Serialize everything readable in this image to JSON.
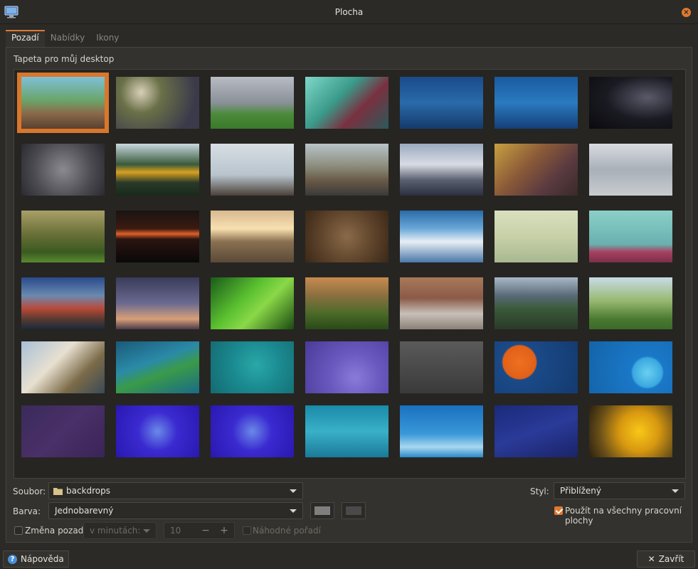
{
  "window": {
    "title": "Plocha"
  },
  "tabs": [
    {
      "label": "Pozadí",
      "active": true
    },
    {
      "label": "Nabídky",
      "active": false
    },
    {
      "label": "Ikony",
      "active": false
    }
  ],
  "group_label": "Tapeta pro můj desktop",
  "wallpapers": [
    {
      "name": "zen-stones"
    },
    {
      "name": "flower-bokeh"
    },
    {
      "name": "tree-field"
    },
    {
      "name": "teal-mountain"
    },
    {
      "name": "blue-aurora-1"
    },
    {
      "name": "blue-aurora-2"
    },
    {
      "name": "milky-way"
    },
    {
      "name": "pebbles"
    },
    {
      "name": "golden-pavilion"
    },
    {
      "name": "rail-pier"
    },
    {
      "name": "lighthouse"
    },
    {
      "name": "matterhorn"
    },
    {
      "name": "squirrel-tree"
    },
    {
      "name": "frost-plant"
    },
    {
      "name": "misty-forest"
    },
    {
      "name": "red-sunset"
    },
    {
      "name": "road-sunset"
    },
    {
      "name": "sand-texture"
    },
    {
      "name": "clouds-sky"
    },
    {
      "name": "tree-reflection"
    },
    {
      "name": "pink-horizon"
    },
    {
      "name": "red-rocks"
    },
    {
      "name": "bare-tree-dusk"
    },
    {
      "name": "green-leaf"
    },
    {
      "name": "grass-bokeh"
    },
    {
      "name": "cat-street"
    },
    {
      "name": "mountain-cabin"
    },
    {
      "name": "wheat-field"
    },
    {
      "name": "cherry-blossom"
    },
    {
      "name": "teal-abstract"
    },
    {
      "name": "teal-circle"
    },
    {
      "name": "purple-circle"
    },
    {
      "name": "grey-mountains"
    },
    {
      "name": "orange-sun"
    },
    {
      "name": "blue-circle"
    },
    {
      "name": "purple-stars"
    },
    {
      "name": "violet-bubbles-1"
    },
    {
      "name": "violet-bubbles-2"
    },
    {
      "name": "teal-waves"
    },
    {
      "name": "blue-waves"
    },
    {
      "name": "blue-triangles"
    },
    {
      "name": "yellow-flower-bee"
    }
  ],
  "selected_index": 0,
  "form": {
    "file_label": "Soubor:",
    "file_value": "backdrops",
    "style_label": "Styl:",
    "style_value": "Přiblížený",
    "color_label": "Barva:",
    "color_value": "Jednobarevný",
    "color1": "#7f7f7f",
    "color2": "#4a4a4a",
    "apply_all_label": "Použít na všechny pracovní plochy",
    "apply_all_checked": true,
    "change_bg_label": "Změna pozadí",
    "change_bg_checked": false,
    "interval_unit": "v minutách:",
    "interval_value": "10",
    "random_label": "Náhodné pořadí",
    "random_checked": false
  },
  "buttons": {
    "help": "Nápověda",
    "close": "Zavřít"
  },
  "colors": {
    "accent": "#e0782f"
  }
}
